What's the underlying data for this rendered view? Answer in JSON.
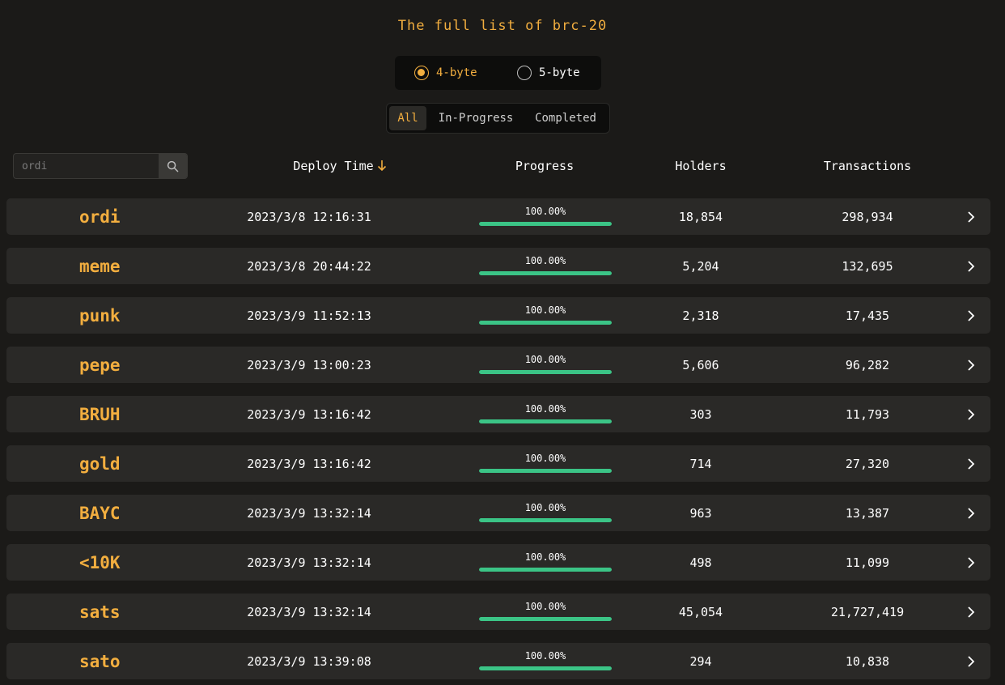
{
  "title": "The full list of brc-20",
  "byte_options": [
    {
      "label": "4-byte",
      "checked": true
    },
    {
      "label": "5-byte",
      "checked": false
    }
  ],
  "status_tabs": [
    "All",
    "In-Progress",
    "Completed"
  ],
  "active_tab": "All",
  "search": {
    "placeholder": "ordi",
    "value": ""
  },
  "columns": {
    "deploy_time": "Deploy Time",
    "progress": "Progress",
    "holders": "Holders",
    "transactions": "Transactions"
  },
  "colors": {
    "accent": "#f2ae3f",
    "progress": "#3bc486",
    "row_bg": "#2a2927"
  },
  "icons": {
    "search": "search-icon",
    "sort": "arrow-down-icon",
    "row": "chevron-right-icon"
  },
  "rows": [
    {
      "ticker": "ordi",
      "deploy_time": "2023/3/8 12:16:31",
      "progress_label": "100.00%",
      "progress": 1.0,
      "holders": "18,854",
      "transactions": "298,934"
    },
    {
      "ticker": "meme",
      "deploy_time": "2023/3/8 20:44:22",
      "progress_label": "100.00%",
      "progress": 1.0,
      "holders": "5,204",
      "transactions": "132,695"
    },
    {
      "ticker": "punk",
      "deploy_time": "2023/3/9 11:52:13",
      "progress_label": "100.00%",
      "progress": 1.0,
      "holders": "2,318",
      "transactions": "17,435"
    },
    {
      "ticker": "pepe",
      "deploy_time": "2023/3/9 13:00:23",
      "progress_label": "100.00%",
      "progress": 1.0,
      "holders": "5,606",
      "transactions": "96,282"
    },
    {
      "ticker": "BRUH",
      "deploy_time": "2023/3/9 13:16:42",
      "progress_label": "100.00%",
      "progress": 1.0,
      "holders": "303",
      "transactions": "11,793"
    },
    {
      "ticker": "gold",
      "deploy_time": "2023/3/9 13:16:42",
      "progress_label": "100.00%",
      "progress": 1.0,
      "holders": "714",
      "transactions": "27,320"
    },
    {
      "ticker": "BAYC",
      "deploy_time": "2023/3/9 13:32:14",
      "progress_label": "100.00%",
      "progress": 1.0,
      "holders": "963",
      "transactions": "13,387"
    },
    {
      "ticker": "<10K",
      "deploy_time": "2023/3/9 13:32:14",
      "progress_label": "100.00%",
      "progress": 1.0,
      "holders": "498",
      "transactions": "11,099"
    },
    {
      "ticker": "sats",
      "deploy_time": "2023/3/9 13:32:14",
      "progress_label": "100.00%",
      "progress": 1.0,
      "holders": "45,054",
      "transactions": "21,727,419"
    },
    {
      "ticker": "sato",
      "deploy_time": "2023/3/9 13:39:08",
      "progress_label": "100.00%",
      "progress": 1.0,
      "holders": "294",
      "transactions": "10,838"
    }
  ]
}
